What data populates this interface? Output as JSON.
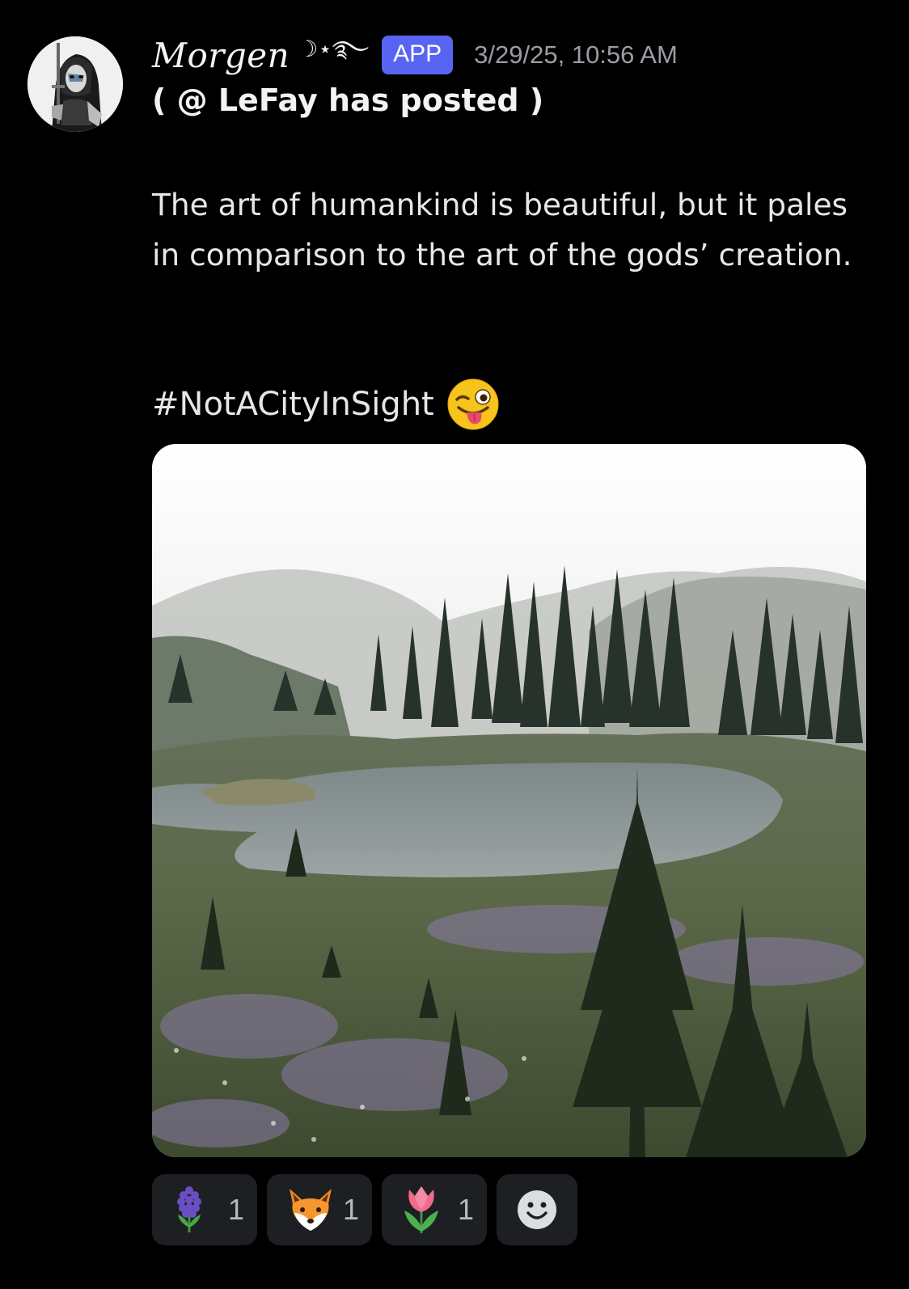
{
  "message": {
    "author": {
      "display_name": "Morgen",
      "name_decoration": "☽⋆࿐",
      "badge": "APP",
      "avatar_icon": "avatar-dark-warrior"
    },
    "timestamp": "3/29/25, 10:56 AM",
    "subtitle": "( @ LeFay has posted )",
    "body": "The art of humankind is beautiful, but it pales in comparison to the art of the gods’ creation.",
    "hashtag": "#NotACityInSight",
    "hashtag_emoji": "winking-face-with-tongue",
    "image": {
      "subject": "mountain-lake-with-fir-trees-and-fog",
      "alt": ""
    },
    "reactions": [
      {
        "emoji": "hyacinth",
        "count": "1"
      },
      {
        "emoji": "fox",
        "count": "1"
      },
      {
        "emoji": "tulip",
        "count": "1"
      }
    ],
    "add_reaction_icon": "add-reaction-smiley"
  },
  "colors": {
    "background": "#000000",
    "badge": "#5865f2",
    "timestamp": "#9a9ea4",
    "reaction_bg": "#1e1f22"
  }
}
